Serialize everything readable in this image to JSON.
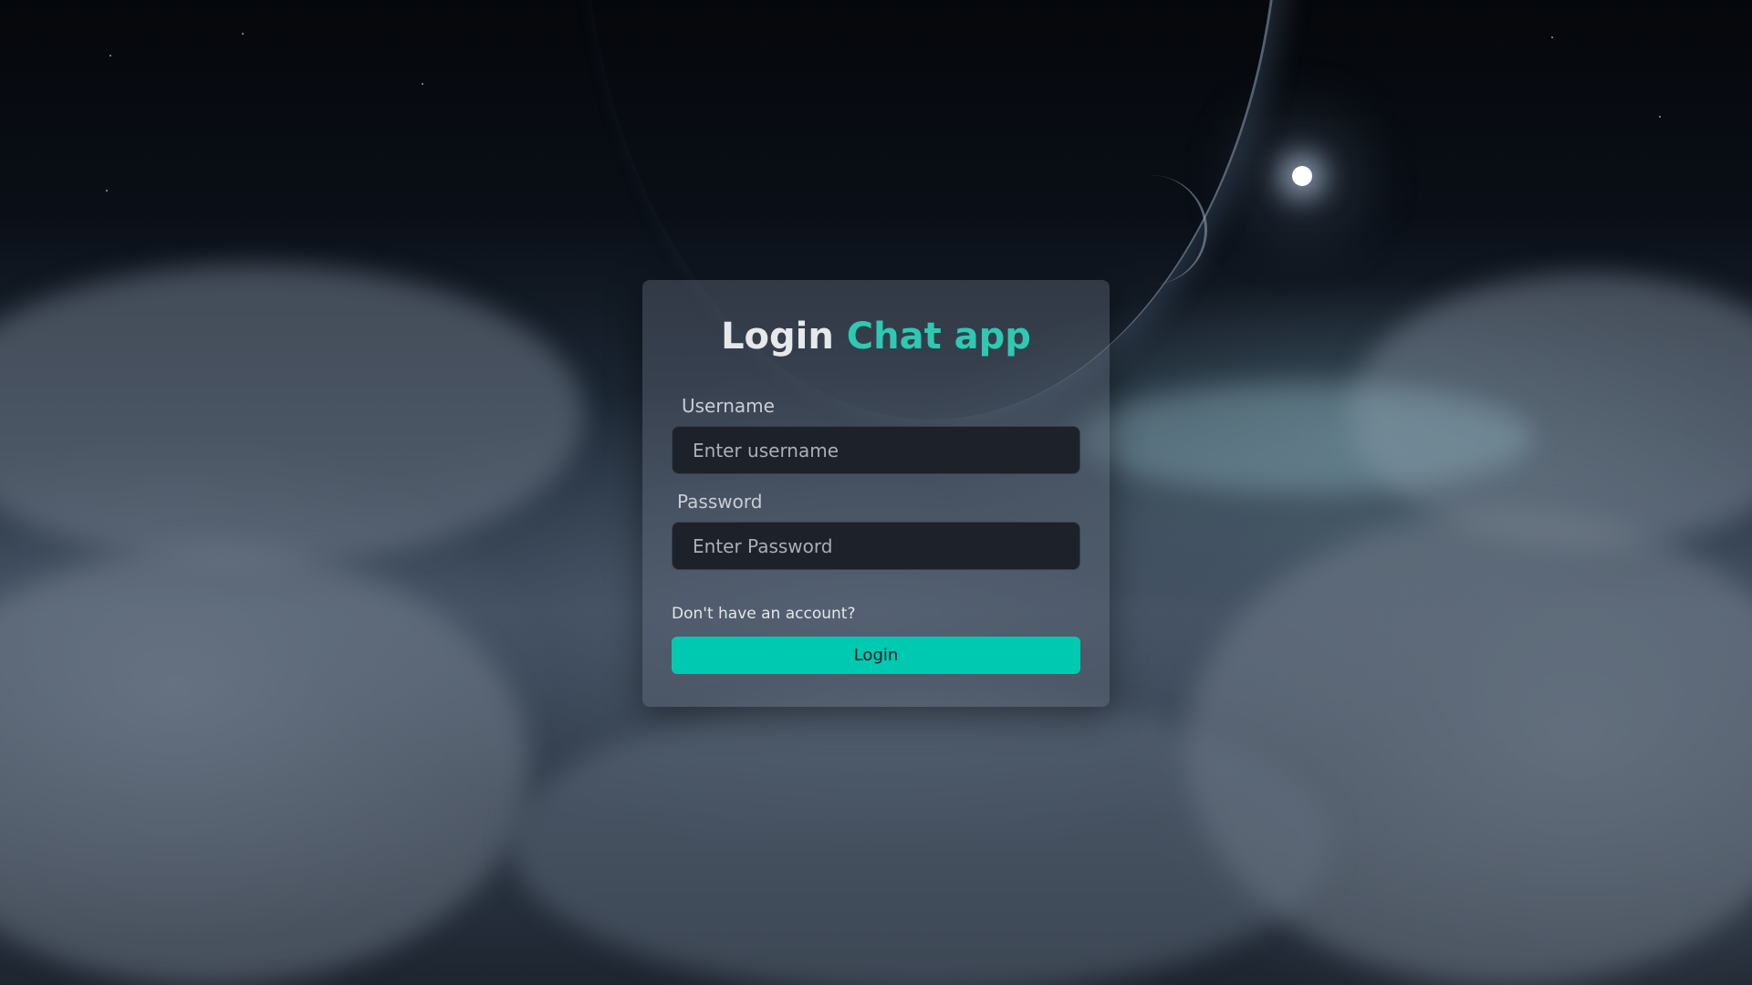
{
  "login": {
    "title_main": "Login",
    "title_accent": "Chat app",
    "username_label": "Username",
    "username_placeholder": "Enter username",
    "password_label": "Password",
    "password_placeholder": "Enter Password",
    "signup_link": "Don't have an account?",
    "login_button": "Login"
  },
  "colors": {
    "accent": "#2fc9b2",
    "button": "#00c9b1",
    "input_bg": "#1d2129"
  }
}
